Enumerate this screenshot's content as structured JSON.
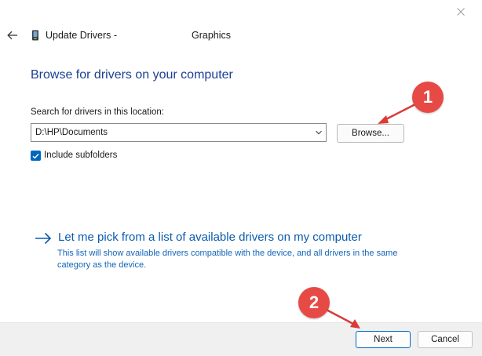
{
  "window": {
    "title": "Update Drivers -",
    "device_name": "Graphics",
    "icons": {
      "back": "back-arrow-icon",
      "device": "device-icon",
      "close": "close-icon"
    }
  },
  "main": {
    "heading": "Browse for drivers on your computer",
    "search_label": "Search for drivers in this location:",
    "path_value": "D:\\HP\\Documents",
    "browse_label": "Browse...",
    "include_subfolders_label": "Include subfolders",
    "include_subfolders_checked": true
  },
  "pick": {
    "link_text": "Let me pick from a list of available drivers on my computer",
    "description": "This list will show available drivers compatible with the device, and all drivers in the same category as the device."
  },
  "footer": {
    "next_label": "Next",
    "cancel_label": "Cancel"
  },
  "annotations": {
    "badge_1": "1",
    "badge_2": "2",
    "color": "#e74a45"
  },
  "colors": {
    "accent": "#0067c0",
    "heading": "#1c3f94",
    "link": "#0b5cad"
  }
}
